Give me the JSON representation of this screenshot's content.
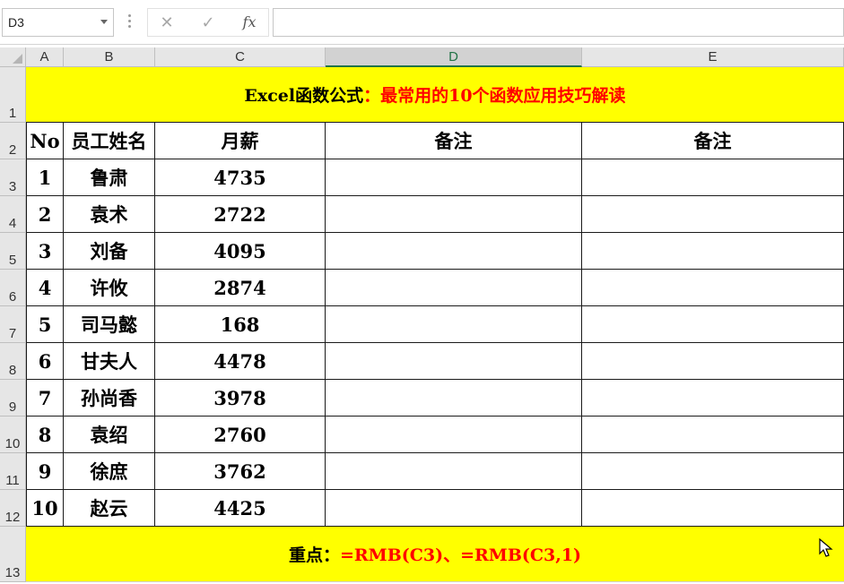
{
  "name_box": "D3",
  "formula_buttons": {
    "cancel": "✕",
    "enter": "✓",
    "fx": "fx"
  },
  "formula_value": "",
  "columns": [
    "A",
    "B",
    "C",
    "D",
    "E"
  ],
  "selected_column": "D",
  "rows": [
    "1",
    "2",
    "3",
    "4",
    "5",
    "6",
    "7",
    "8",
    "9",
    "10",
    "11",
    "12",
    "13"
  ],
  "title": {
    "black": "Excel函数公式",
    "red": "：最常用的10个函数应用技巧解读"
  },
  "headers": [
    "No",
    "员工姓名",
    "月薪",
    "备注",
    "备注"
  ],
  "records": [
    {
      "no": "1",
      "name": "鲁肃",
      "salary": "4735"
    },
    {
      "no": "2",
      "name": "袁术",
      "salary": "2722"
    },
    {
      "no": "3",
      "name": "刘备",
      "salary": "4095"
    },
    {
      "no": "4",
      "name": "许攸",
      "salary": "2874"
    },
    {
      "no": "5",
      "name": "司马懿",
      "salary": "168"
    },
    {
      "no": "6",
      "name": "甘夫人",
      "salary": "4478"
    },
    {
      "no": "7",
      "name": "孙尚香",
      "salary": "3978"
    },
    {
      "no": "8",
      "name": "袁绍",
      "salary": "2760"
    },
    {
      "no": "9",
      "name": "徐庶",
      "salary": "3762"
    },
    {
      "no": "10",
      "name": "赵云",
      "salary": "4425"
    }
  ],
  "footer": {
    "black": "重点：",
    "red": "=RMB(C3)、=RMB(C3,1)"
  },
  "colors": {
    "yellow": "#ffff00",
    "red": "#ff0000",
    "excel_green": "#217346"
  }
}
